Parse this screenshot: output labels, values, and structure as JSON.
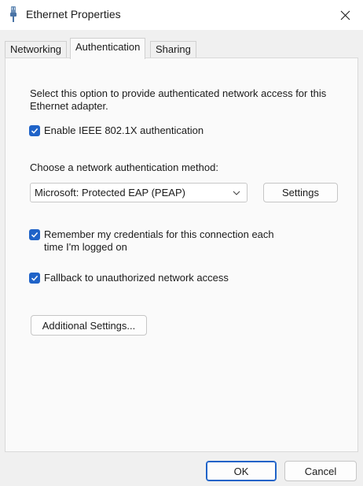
{
  "window": {
    "title": "Ethernet Properties"
  },
  "tabs": [
    {
      "label": "Networking"
    },
    {
      "label": "Authentication"
    },
    {
      "label": "Sharing"
    }
  ],
  "auth": {
    "description": "Select this option to provide authenticated network access for this Ethernet adapter.",
    "enable_8021x_label": "Enable IEEE 802.1X authentication",
    "method_label": "Choose a network authentication method:",
    "method_selected": "Microsoft: Protected EAP (PEAP)",
    "settings_button": "Settings",
    "remember_label": "Remember my credentials for this connection each time I'm logged on",
    "fallback_label": "Fallback to unauthorized network access",
    "additional_button": "Additional Settings..."
  },
  "footer": {
    "ok_label": "OK",
    "cancel_label": "Cancel"
  },
  "colors": {
    "accent": "#1f63c8"
  }
}
